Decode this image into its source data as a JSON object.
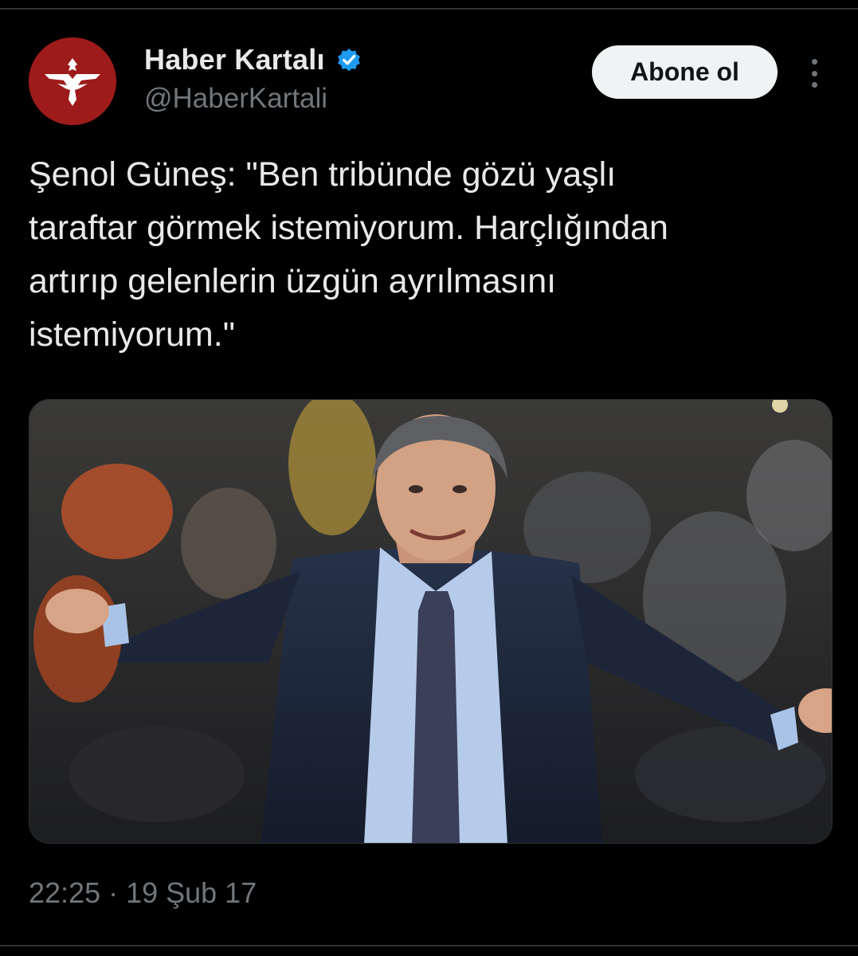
{
  "account": {
    "display_name": "Haber Kartalı",
    "handle": "@HaberKartali",
    "verified": true,
    "avatar_icon": "eagle-logo-icon",
    "avatar_color": "#9e1b1b",
    "verified_color": "#1d9bf0"
  },
  "actions": {
    "follow_label": "Abone ol",
    "more_icon": "more-vertical-icon"
  },
  "tweet": {
    "text": "Şenol Güneş: \"Ben tribünde gözü yaşlı\ntaraftar görmek istemiyorum. Harçlığından\nartırıp gelenlerin üzgün ayrılmasını\nistemiyorum.\""
  },
  "media": {
    "alt": ""
  },
  "meta": {
    "timestamp": "22:25 · 19 Şub 17"
  },
  "colors": {
    "background": "#000000",
    "text_primary": "#e7e9ea",
    "text_secondary": "#71767b",
    "button_bg": "#eff3f4",
    "button_text": "#0f1419"
  }
}
